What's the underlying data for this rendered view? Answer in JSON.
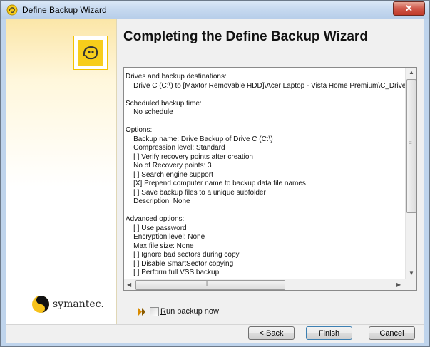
{
  "window": {
    "title": "Define Backup Wizard",
    "close_glyph": "✕"
  },
  "sidebar": {
    "brand_text": "symantec."
  },
  "main": {
    "heading": "Completing the Define Backup Wizard",
    "summary_lines": [
      "Drives and backup destinations:",
      "    Drive C (C:\\) to [Maxtor Removable HDD]\\Acer Laptop - Vista Home Premium\\C_DriveC",
      "",
      "Scheduled backup time:",
      "    No schedule",
      "",
      "Options:",
      "    Backup name: Drive Backup of Drive C (C:\\)",
      "    Compression level: Standard",
      "    [ ] Verify recovery points after creation",
      "    No of Recovery points: 3",
      "    [ ] Search engine support",
      "    [X] Prepend computer name to backup data file names",
      "    [ ] Save backup files to a unique subfolder",
      "    Description: None",
      "",
      "Advanced options:",
      "    [ ] Use password",
      "    Encryption level: None",
      "    Max file size: None",
      "    [ ] Ignore bad sectors during copy",
      "    [ ] Disable SmartSector copying",
      "    [ ] Perform full VSS backup"
    ],
    "run_backup_label": "Run backup now",
    "run_backup_checked": false
  },
  "buttons": {
    "back": "< Back",
    "finish": "Finish",
    "cancel": "Cancel"
  },
  "colors": {
    "brand_yellow": "#f7cd1b",
    "title_close_red": "#c03a2a"
  },
  "icons": {
    "title": "symantec-ghost-icon",
    "sidebar_logo": "ghost-logo-icon",
    "brand": "symantec-logo-icon",
    "run": "double-arrow-icon"
  }
}
